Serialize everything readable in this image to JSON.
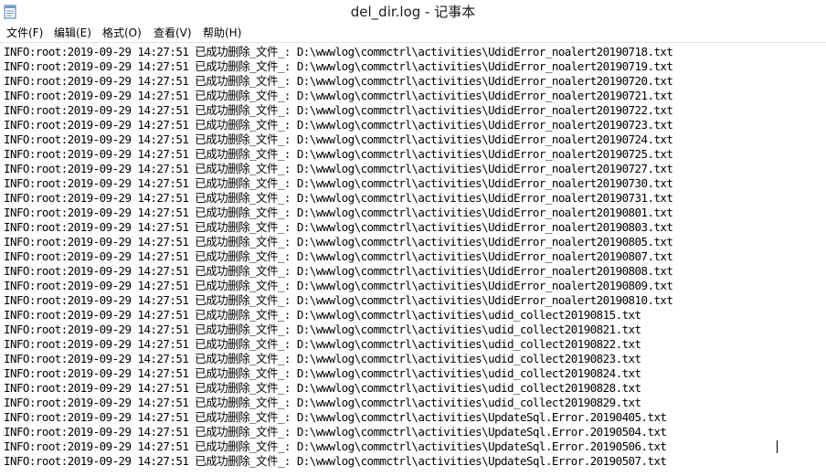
{
  "window": {
    "title": "del_dir.log - 记事本",
    "icon": "notepad-icon"
  },
  "menu": [
    "文件(F)",
    "编辑(E)",
    "格式(O)",
    "查看(V)",
    "帮助(H)"
  ],
  "lines": [
    "INFO:root:2019-09-29 14:27:51 已成功删除_文件_: D:\\wwwlog\\commctrl\\activities\\UdidError_noalert20190718.txt",
    "INFO:root:2019-09-29 14:27:51 已成功删除_文件_: D:\\wwwlog\\commctrl\\activities\\UdidError_noalert20190719.txt",
    "INFO:root:2019-09-29 14:27:51 已成功删除_文件_: D:\\wwwlog\\commctrl\\activities\\UdidError_noalert20190720.txt",
    "INFO:root:2019-09-29 14:27:51 已成功删除_文件_: D:\\wwwlog\\commctrl\\activities\\UdidError_noalert20190721.txt",
    "INFO:root:2019-09-29 14:27:51 已成功删除_文件_: D:\\wwwlog\\commctrl\\activities\\UdidError_noalert20190722.txt",
    "INFO:root:2019-09-29 14:27:51 已成功删除_文件_: D:\\wwwlog\\commctrl\\activities\\UdidError_noalert20190723.txt",
    "INFO:root:2019-09-29 14:27:51 已成功删除_文件_: D:\\wwwlog\\commctrl\\activities\\UdidError_noalert20190724.txt",
    "INFO:root:2019-09-29 14:27:51 已成功删除_文件_: D:\\wwwlog\\commctrl\\activities\\UdidError_noalert20190725.txt",
    "INFO:root:2019-09-29 14:27:51 已成功删除_文件_: D:\\wwwlog\\commctrl\\activities\\UdidError_noalert20190727.txt",
    "INFO:root:2019-09-29 14:27:51 已成功删除_文件_: D:\\wwwlog\\commctrl\\activities\\UdidError_noalert20190730.txt",
    "INFO:root:2019-09-29 14:27:51 已成功删除_文件_: D:\\wwwlog\\commctrl\\activities\\UdidError_noalert20190731.txt",
    "INFO:root:2019-09-29 14:27:51 已成功删除_文件_: D:\\wwwlog\\commctrl\\activities\\UdidError_noalert20190801.txt",
    "INFO:root:2019-09-29 14:27:51 已成功删除_文件_: D:\\wwwlog\\commctrl\\activities\\UdidError_noalert20190803.txt",
    "INFO:root:2019-09-29 14:27:51 已成功删除_文件_: D:\\wwwlog\\commctrl\\activities\\UdidError_noalert20190805.txt",
    "INFO:root:2019-09-29 14:27:51 已成功删除_文件_: D:\\wwwlog\\commctrl\\activities\\UdidError_noalert20190807.txt",
    "INFO:root:2019-09-29 14:27:51 已成功删除_文件_: D:\\wwwlog\\commctrl\\activities\\UdidError_noalert20190808.txt",
    "INFO:root:2019-09-29 14:27:51 已成功删除_文件_: D:\\wwwlog\\commctrl\\activities\\UdidError_noalert20190809.txt",
    "INFO:root:2019-09-29 14:27:51 已成功删除_文件_: D:\\wwwlog\\commctrl\\activities\\UdidError_noalert20190810.txt",
    "INFO:root:2019-09-29 14:27:51 已成功删除_文件_: D:\\wwwlog\\commctrl\\activities\\udid_collect20190815.txt",
    "INFO:root:2019-09-29 14:27:51 已成功删除_文件_: D:\\wwwlog\\commctrl\\activities\\udid_collect20190821.txt",
    "INFO:root:2019-09-29 14:27:51 已成功删除_文件_: D:\\wwwlog\\commctrl\\activities\\udid_collect20190822.txt",
    "INFO:root:2019-09-29 14:27:51 已成功删除_文件_: D:\\wwwlog\\commctrl\\activities\\udid_collect20190823.txt",
    "INFO:root:2019-09-29 14:27:51 已成功删除_文件_: D:\\wwwlog\\commctrl\\activities\\udid_collect20190824.txt",
    "INFO:root:2019-09-29 14:27:51 已成功删除_文件_: D:\\wwwlog\\commctrl\\activities\\udid_collect20190828.txt",
    "INFO:root:2019-09-29 14:27:51 已成功删除_文件_: D:\\wwwlog\\commctrl\\activities\\udid_collect20190829.txt",
    "INFO:root:2019-09-29 14:27:51 已成功删除_文件_: D:\\wwwlog\\commctrl\\activities\\UpdateSql.Error.20190405.txt",
    "INFO:root:2019-09-29 14:27:51 已成功删除_文件_: D:\\wwwlog\\commctrl\\activities\\UpdateSql.Error.20190504.txt",
    "INFO:root:2019-09-29 14:27:51 已成功删除_文件_: D:\\wwwlog\\commctrl\\activities\\UpdateSql.Error.20190506.txt",
    "INFO:root:2019-09-29 14:27:51 已成功删除_文件_: D:\\wwwlog\\commctrl\\activities\\UpdateSql.Error.20190507.txt"
  ],
  "colors": {
    "background": "#ffffff",
    "text": "#000000",
    "menu_border": "#e3e3e3"
  }
}
